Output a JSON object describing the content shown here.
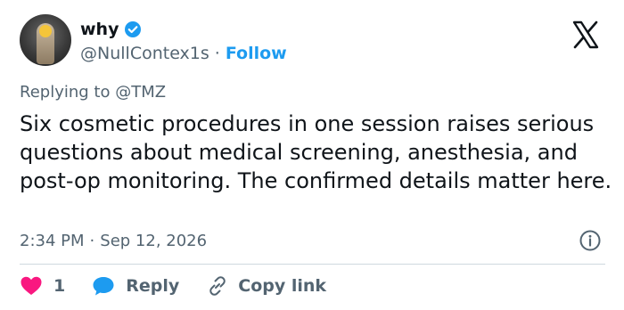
{
  "author": {
    "name": "why",
    "handle": "@NullContex1s",
    "separator": "·",
    "follow_label": "Follow"
  },
  "reply_context": {
    "prefix": "Replying to",
    "mention": "@TMZ"
  },
  "tweet": {
    "text": "Six cosmetic procedures in one session raises serious questions about medical screening, anesthesia, and post-op monitoring. The confirmed details matter here.",
    "time": "2:34 PM",
    "separator": "·",
    "date": "Sep 12, 2026"
  },
  "actions": {
    "like_count": "1",
    "reply_label": "Reply",
    "copy_link_label": "Copy link"
  },
  "icons": {
    "verified": "verified-badge-icon",
    "logo": "x-logo-icon",
    "info": "info-icon",
    "like": "heart-icon",
    "reply": "speech-bubble-icon",
    "copy_link": "link-icon"
  },
  "colors": {
    "accent": "#1d9bf0",
    "like": "#f91880",
    "text": "#0f1419",
    "muted": "#536471",
    "divider": "#cfd9de"
  }
}
